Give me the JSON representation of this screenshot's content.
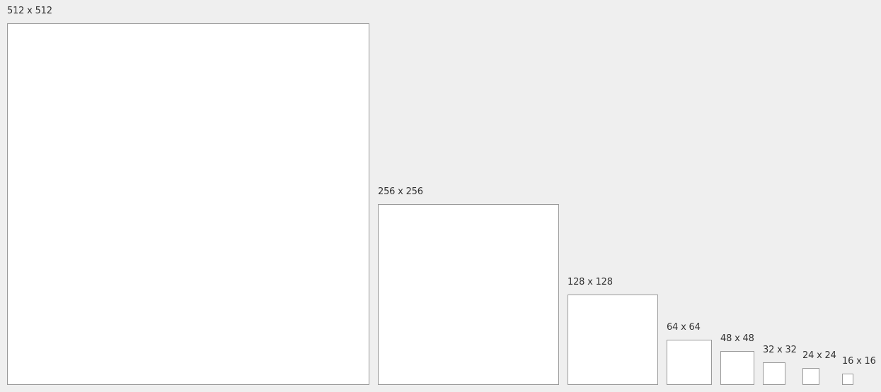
{
  "tiles": [
    {
      "label": "512 x 512",
      "size": 512
    },
    {
      "label": "256 x 256",
      "size": 256
    },
    {
      "label": "128 x 128",
      "size": 128
    },
    {
      "label": "64 x 64",
      "size": 64
    },
    {
      "label": "48 x 48",
      "size": 48
    },
    {
      "label": "32 x 32",
      "size": 32
    },
    {
      "label": "24 x 24",
      "size": 24
    },
    {
      "label": "16 x 16",
      "size": 16
    }
  ],
  "colors": {
    "background": "#efefef",
    "box_fill": "#ffffff",
    "box_border": "#9a9a9a",
    "label_text": "#333333"
  }
}
